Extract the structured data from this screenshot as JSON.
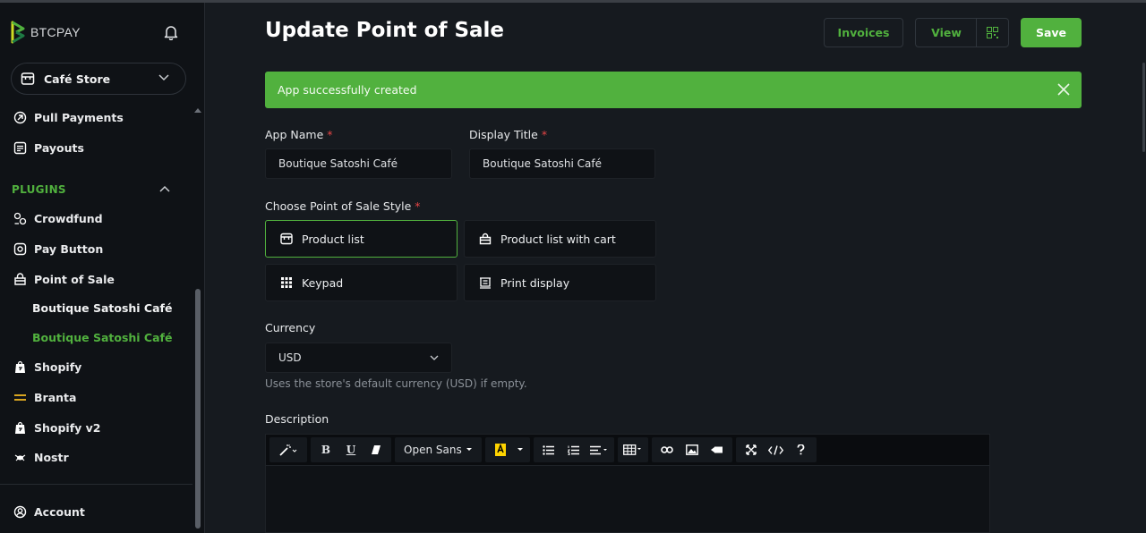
{
  "brand": {
    "name": "BTCPAY"
  },
  "store_selector": {
    "label": "Café Store"
  },
  "sidebar": {
    "items_top": [
      {
        "label": "Pull Payments",
        "icon": "pull-payments-icon"
      },
      {
        "label": "Payouts",
        "icon": "payouts-icon"
      }
    ],
    "plugins_header": "PLUGINS",
    "plugins": [
      {
        "label": "Crowdfund",
        "icon": "crowdfund-icon"
      },
      {
        "label": "Pay Button",
        "icon": "pay-button-icon"
      },
      {
        "label": "Point of Sale",
        "icon": "pos-icon"
      }
    ],
    "pos_apps": [
      {
        "label": "Boutique Satoshi Café",
        "active": false
      },
      {
        "label": "Boutique Satoshi Café",
        "active": true
      }
    ],
    "plugins_more": [
      {
        "label": "Shopify",
        "icon": "shopify-icon"
      },
      {
        "label": "Branta",
        "icon": "branta-icon"
      },
      {
        "label": "Shopify v2",
        "icon": "shopify-icon"
      },
      {
        "label": "Nostr",
        "icon": "nostr-icon"
      }
    ],
    "account": "Account"
  },
  "header": {
    "title": "Update Point of Sale",
    "invoices_label": "Invoices",
    "view_label": "View",
    "save_label": "Save"
  },
  "alert": {
    "message": "App successfully created"
  },
  "form": {
    "app_name_label": "App Name",
    "app_name_value": "Boutique Satoshi Café",
    "display_title_label": "Display Title",
    "display_title_value": "Boutique Satoshi Café",
    "required_mark": "*",
    "style_label": "Choose Point of Sale Style",
    "styles": [
      {
        "label": "Product list",
        "selected": true
      },
      {
        "label": "Product list with cart",
        "selected": false
      },
      {
        "label": "Keypad",
        "selected": false
      },
      {
        "label": "Print display",
        "selected": false
      }
    ],
    "currency_label": "Currency",
    "currency_value": "USD",
    "currency_hint": "Uses the store's default currency (USD) if empty.",
    "description_label": "Description"
  },
  "editor_toolbar": {
    "font_name": "Open Sans"
  },
  "colors": {
    "accent": "#51b13e",
    "background": "#161a1f",
    "sidebar": "#0f1216",
    "required": "#e64545"
  }
}
